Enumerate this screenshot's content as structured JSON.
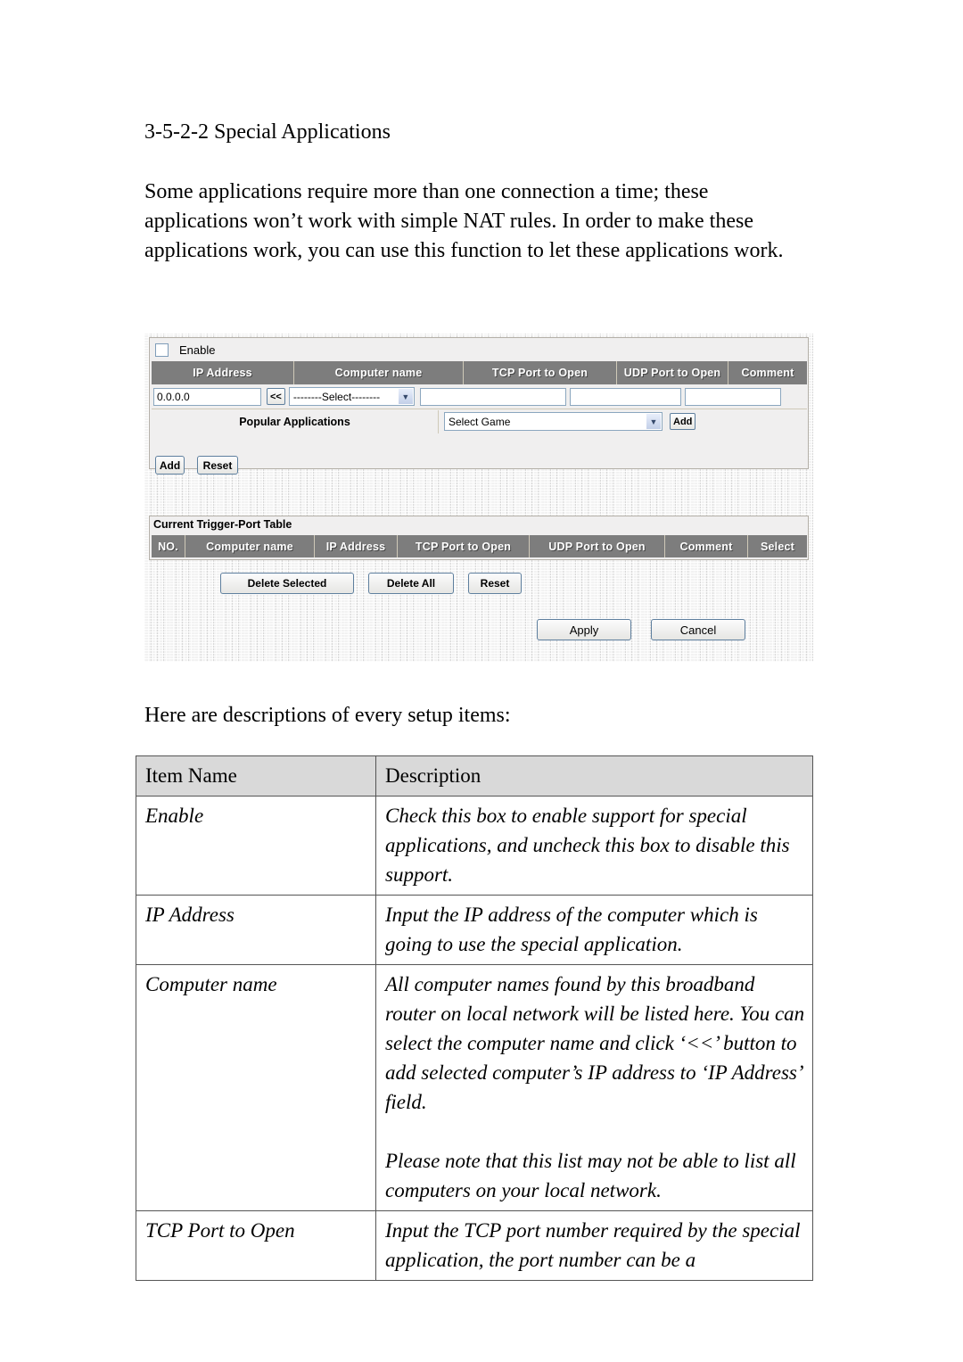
{
  "document": {
    "heading": "3-5-2-2 Special Applications",
    "paragraph": "Some applications require more than one connection a time; these applications won’t work with simple NAT rules. In order to make these applications work, you can use this function to let these applications work.",
    "paragraph2": "Here are descriptions of every setup items:"
  },
  "screenshot": {
    "enable": {
      "label": "Enable",
      "checked": false
    },
    "config_table": {
      "headers": [
        "IP Address",
        "Computer name",
        "TCP Port to Open",
        "UDP Port to Open",
        "Comment"
      ],
      "ip_address_value": "0.0.0.0",
      "copy_button_label": "<<",
      "computer_name_value": "--------Select--------",
      "tcp_port_value": "",
      "udp_port_value": "",
      "comment_value": ""
    },
    "popular_applications": {
      "label": "Popular Applications",
      "select_value": "Select Game",
      "add_label": "Add"
    },
    "form_buttons": {
      "add": "Add",
      "reset": "Reset"
    },
    "trigger_table": {
      "title": "Current Trigger-Port Table",
      "headers": [
        "NO.",
        "Computer name",
        "IP Address",
        "TCP Port to Open",
        "UDP Port to Open",
        "Comment",
        "Select"
      ],
      "rows": []
    },
    "table_buttons": {
      "delete_selected": "Delete Selected",
      "delete_all": "Delete All",
      "reset": "Reset"
    },
    "footer_buttons": {
      "apply": "Apply",
      "cancel": "Cancel"
    },
    "colors": {
      "header_bg": "#7d7d7d",
      "header_text": "#ffffff",
      "panel_bg": "#f0efef",
      "page_bg": "#f2f2f2",
      "input_border": "#8ba7bf"
    }
  },
  "descriptions": {
    "headers": [
      "Item Name",
      "Description"
    ],
    "rows": [
      {
        "item": "Enable",
        "description": "Check this box to enable support for special applications, and uncheck this box to disable this support."
      },
      {
        "item": "IP Address",
        "description": "Input the IP address of the computer which is going to use the special application."
      },
      {
        "item": "Computer name",
        "description_part1": "All computer names found by this broadband router on local network will be listed here. You can select the computer name and click ‘<<’ button to add selected computer’s IP address to ‘IP Address’ field.",
        "description_part2": "Please note that this list may not be able to list all computers on your local network."
      },
      {
        "item": "TCP Port to Open",
        "description": "Input the TCP port number required by the special application, the port number can be a"
      }
    ]
  }
}
